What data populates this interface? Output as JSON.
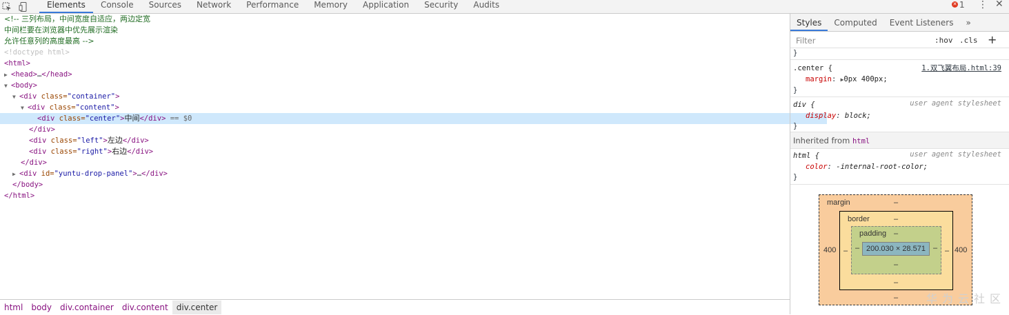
{
  "toolbar": {
    "inspect_icon": "cursor-select-icon",
    "device_icon": "mobile-device-icon",
    "tabs": [
      "Elements",
      "Console",
      "Sources",
      "Network",
      "Performance",
      "Memory",
      "Application",
      "Security",
      "Audits"
    ],
    "active_tab": "Elements",
    "error_count": "1",
    "error_symbol": "✕",
    "menu_glyph": "⋮",
    "close_glyph": "✕"
  },
  "dom": {
    "comment_line1": "<!-- 三列布局，中间宽度自适应，两边定宽",
    "comment_line2": "中间栏要在浏览器中优先展示渲染",
    "comment_line3": "允许任意列的高度最高 -->",
    "doctype": "<!doctype html>",
    "html_open": "<html>",
    "head_open": "<head>",
    "ellipsis": "…",
    "head_close": "</head>",
    "body_open": "<body>",
    "div_open": "<div",
    "class_attr": " class=",
    "id_attr": " id=",
    "gt": ">",
    "div_close": "</div>",
    "container_val": "\"container\"",
    "content_val": "\"content\"",
    "center_val": "\"center\"",
    "center_text": "中间",
    "selected_marker": " == $0",
    "left_val": "\"left\"",
    "left_text": "左边",
    "right_val": "\"right\"",
    "right_text": "右边",
    "panel_val": "\"yuntu-drop-panel\"",
    "body_close": "</body>",
    "html_close": "</html>"
  },
  "breadcrumb": [
    "html",
    "body",
    "div.container",
    "div.content",
    "div.center"
  ],
  "styles": {
    "tabs": [
      "Styles",
      "Computed",
      "Event Listeners"
    ],
    "active_tab": "Styles",
    "more_glyph": "»",
    "filter_placeholder": "Filter",
    "hov": ":hov",
    "cls": ".cls",
    "add_glyph": "+",
    "prev_brace": "}",
    "rule1": {
      "selector": ".center {",
      "source": "1.双飞翼布局.html:39",
      "prop": "margin",
      "colon": ": ",
      "expand_glyph": "▶",
      "value": "0px 400px;",
      "close": "}"
    },
    "rule2": {
      "selector": "div {",
      "source": "user agent stylesheet",
      "prop": "display",
      "colon": ": ",
      "value": "block;",
      "close": "}"
    },
    "inherited_label": "Inherited from ",
    "inherited_tag": "html",
    "rule3": {
      "selector": "html {",
      "source": "user agent stylesheet",
      "prop": "color",
      "colon": ": ",
      "value": "-internal-root-color;",
      "close": "}"
    }
  },
  "box_model": {
    "margin_label": "margin",
    "border_label": "border",
    "padding_label": "padding",
    "dash": "–",
    "margin_left": "400",
    "margin_right": "400",
    "content_size": "200.030 × 28.571"
  },
  "watermark": "华为云社区",
  "colors": {
    "selected_row": "#cfe8fc",
    "tab_accent": "#3879d9",
    "tag": "#881280",
    "attr_name": "#994500",
    "attr_value": "#1a1aa6",
    "comment": "#236e25",
    "margin_box": "#f9cc9d",
    "border_box": "#fbdd9d",
    "padding_box": "#c3d08b",
    "content_box": "#8cb6c0",
    "error": "#e0391f"
  }
}
